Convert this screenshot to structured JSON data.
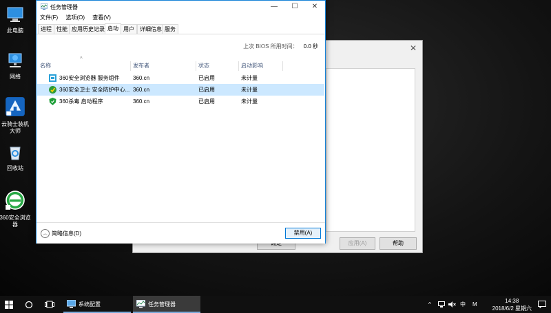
{
  "desktop": {
    "icons": [
      {
        "label": "此电脑",
        "icon": "this-pc-icon"
      },
      {
        "label": "网络",
        "icon": "network-icon"
      },
      {
        "label": "云骑士装机大师",
        "icon": "yunqishi-icon"
      },
      {
        "label": "回收站",
        "icon": "recycle-bin-icon"
      },
      {
        "label": "360安全浏览器",
        "icon": "360-browser-icon"
      }
    ]
  },
  "background_dialog": {
    "buttons": {
      "ok": "确定",
      "apply": "应用(A)",
      "help": "帮助"
    }
  },
  "task_manager": {
    "title": "任务管理器",
    "menu": [
      "文件(F)",
      "选项(O)",
      "查看(V)"
    ],
    "tabs": [
      "进程",
      "性能",
      "应用历史记录",
      "启动",
      "用户",
      "详细信息",
      "服务"
    ],
    "active_tab": "启动",
    "bios_label": "上次 BIOS 所用时间：",
    "bios_value": "0.0 秒",
    "columns": [
      "名称",
      "发布者",
      "状态",
      "启动影响"
    ],
    "rows": [
      {
        "name": "360安全浏览器 服务组件",
        "publisher": "360.cn",
        "status": "已启用",
        "impact": "未计量",
        "icon": "360-browser-component-icon"
      },
      {
        "name": "360安全卫士 安全防护中心...",
        "publisher": "360.cn",
        "status": "已启用",
        "impact": "未计量",
        "icon": "360-safeguard-icon",
        "selected": true
      },
      {
        "name": "360杀毒 启动程序",
        "publisher": "360.cn",
        "status": "已启用",
        "impact": "未计量",
        "icon": "360-antivirus-icon"
      }
    ],
    "footer": {
      "fewer_details": "简略信息(D)",
      "disable": "禁用(A)"
    }
  },
  "taskbar": {
    "apps": [
      {
        "label": "系统配置",
        "icon": "system-config-icon"
      },
      {
        "label": "任务管理器",
        "icon": "task-manager-icon"
      }
    ],
    "tray": {
      "ime": "中",
      "ime2": "M"
    },
    "time": "14:38",
    "date": "2018/6/2 星期六"
  },
  "colors": {
    "accent": "#0078d7",
    "selection": "#cce8ff",
    "taskbar": "#101010"
  }
}
